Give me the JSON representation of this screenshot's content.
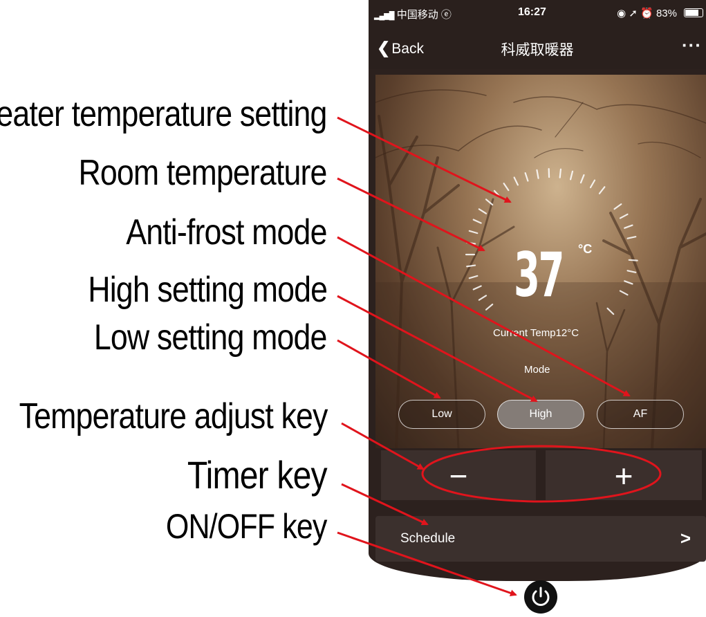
{
  "annotations": {
    "heater_temp_setting": "Heater  temperature  setting",
    "room_temperature": "Room temperature",
    "anti_frost_mode": "Anti-frost mode",
    "high_setting_mode": "High setting mode",
    "low_setting_mode": "Low setting mode",
    "temp_adjust_key": "Temperature adjust key",
    "timer_key": "Timer key",
    "on_off_key": "ON/OFF key"
  },
  "status_bar": {
    "carrier": "中国移动",
    "time": "16:27",
    "battery": "83%",
    "battery_level": 0.83
  },
  "navbar": {
    "back_label": "Back",
    "title": "科威取暖器",
    "more": "···"
  },
  "thermostat": {
    "set_temp": "37",
    "unit": "°C",
    "current_temp_label": "Current Temp12°C"
  },
  "mode": {
    "label": "Mode",
    "options": [
      "Low",
      "High",
      "AF"
    ],
    "selected": "High"
  },
  "adjust": {
    "minus": "−",
    "plus": "+"
  },
  "schedule": {
    "label": "Schedule",
    "chevron": ">"
  },
  "icons": {
    "back": "chevron-left-icon",
    "power": "power-icon",
    "more": "ellipsis-icon"
  },
  "colors": {
    "annotation_arrow": "#e0141c",
    "dark_bg": "#2a201d",
    "active_mode": "#847c77"
  }
}
